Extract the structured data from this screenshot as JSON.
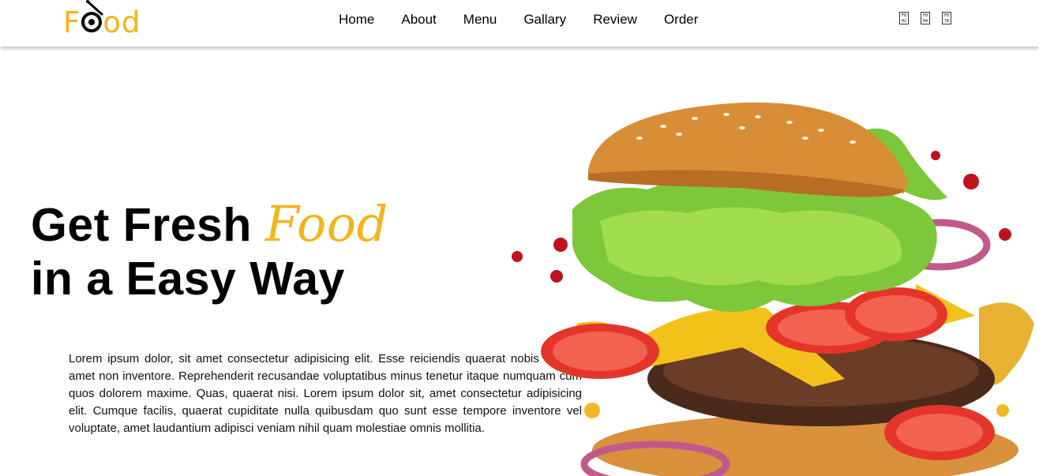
{
  "logo": {
    "brand": "Food",
    "part1": "F",
    "part2": "od"
  },
  "nav": {
    "links": [
      "Home",
      "About",
      "Menu",
      "Gallary",
      "Review",
      "Order"
    ],
    "icons": [
      "search-icon",
      "cart-icon",
      "user-icon"
    ]
  },
  "hero": {
    "title_line1": "Get Fresh",
    "title_accent": "Food",
    "title_line2": "in a Easy Way",
    "description": "Lorem ipsum dolor, sit amet consectetur adipisicing elit. Esse reiciendis quaerat nobis deleniti amet non inventore. Reprehenderit recusandae voluptatibus minus tenetur itaque numquam cum quos dolorem maxime. Quas, quaerat nisi. Lorem ipsum dolor sit, amet consectetur adipisicing elit. Cumque facilis, quaerat cupiditate nulla quibusdam quo sunt esse tempore inventore vel voluptate, amet laudantium adipisci veniam nihil quam molestiae omnis mollitia."
  },
  "colors": {
    "accent": "#f4b41a",
    "text": "#000000",
    "background": "#ffffff"
  }
}
